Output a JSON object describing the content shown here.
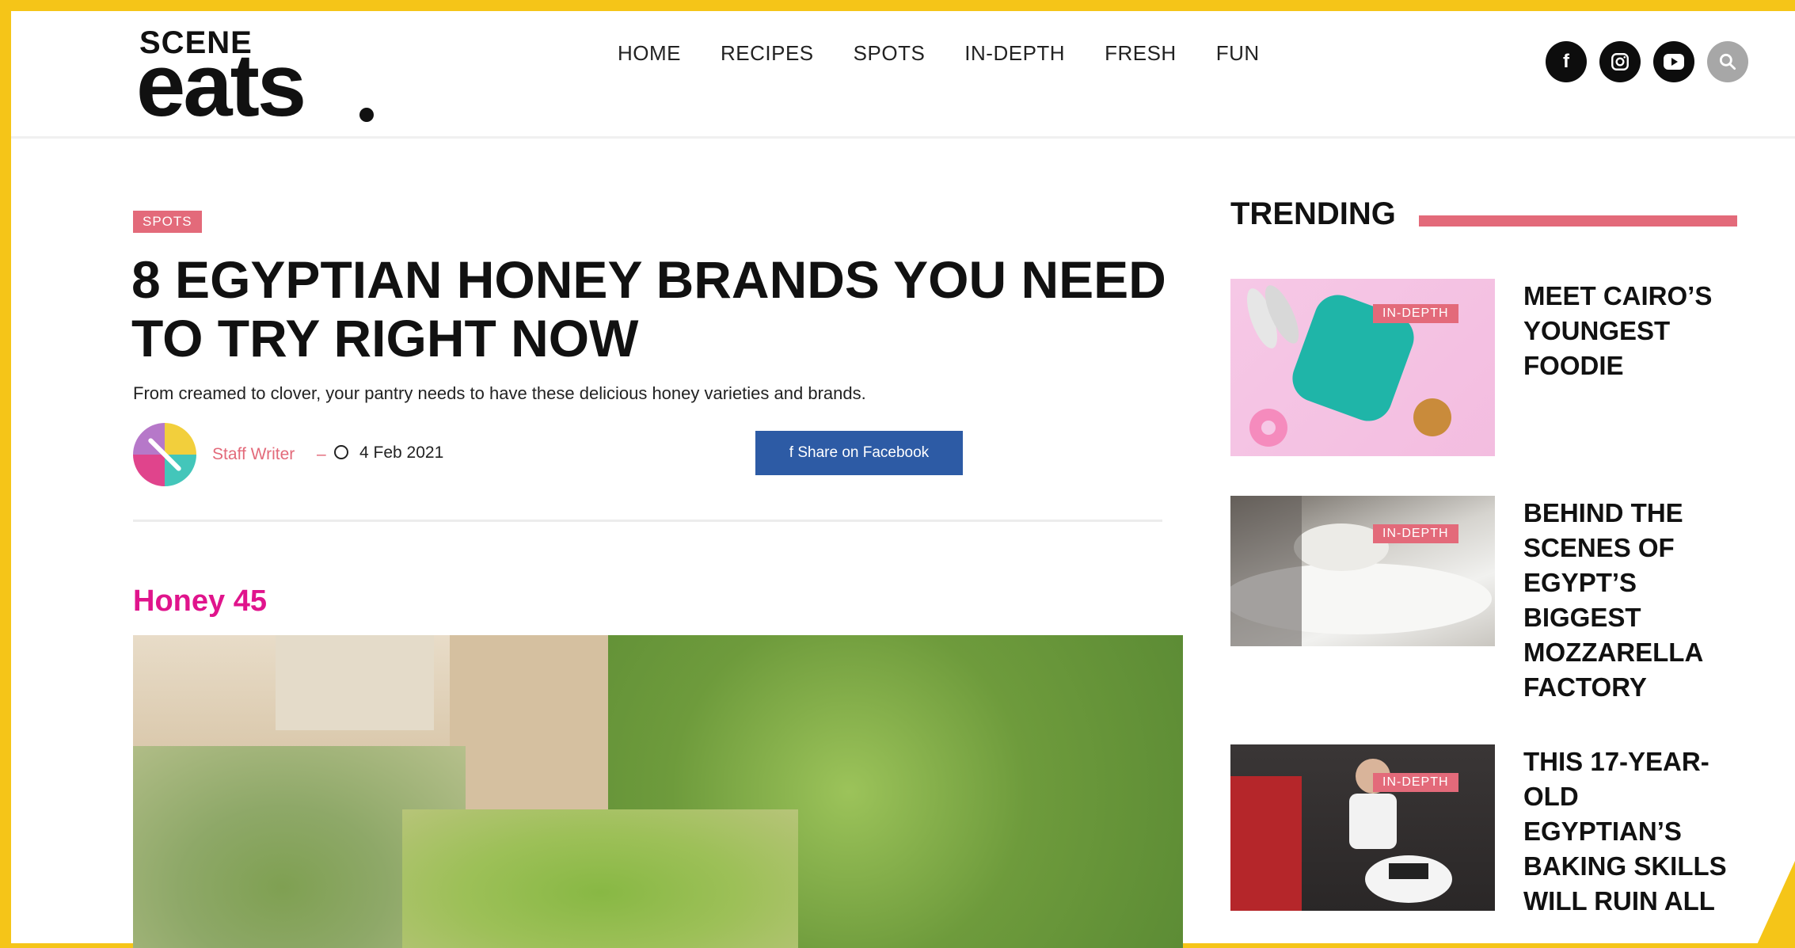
{
  "header": {
    "logo_top": "SCENE",
    "logo_main": "eats",
    "nav": [
      "HOME",
      "RECIPES",
      "SPOTS",
      "IN-DEPTH",
      "FRESH",
      "FUN"
    ],
    "social_icons": [
      "facebook-icon",
      "instagram-icon",
      "youtube-icon",
      "search-icon"
    ]
  },
  "article": {
    "category": "SPOTS",
    "title": "8 EGYPTIAN HONEY BRANDS YOU NEED TO TRY RIGHT NOW",
    "subtitle": "From creamed to clover, your pantry needs to have these delicious honey varieties and brands.",
    "author": "Staff Writer",
    "separator": "–",
    "date": "4 Feb 2021",
    "share_label": "f  Share on Facebook",
    "section_heading": "Honey 45"
  },
  "sidebar": {
    "title": "TRENDING",
    "items": [
      {
        "badge": "IN-DEPTH",
        "title": "MEET CAIRO’S YOUNGEST FOODIE"
      },
      {
        "badge": "IN-DEPTH",
        "title": "BEHIND THE SCENES OF EGYPT’S BIGGEST MOZZARELLA FACTORY"
      },
      {
        "badge": "IN-DEPTH",
        "title": "THIS 17-YEAR-OLD EGYPTIAN’S BAKING SKILLS WILL RUIN ALL"
      }
    ]
  },
  "colors": {
    "accent_pink": "#e36a7a",
    "section_magenta": "#e0148c",
    "facebook_blue": "#2d5ba5",
    "frame_yellow": "#f5c518"
  }
}
